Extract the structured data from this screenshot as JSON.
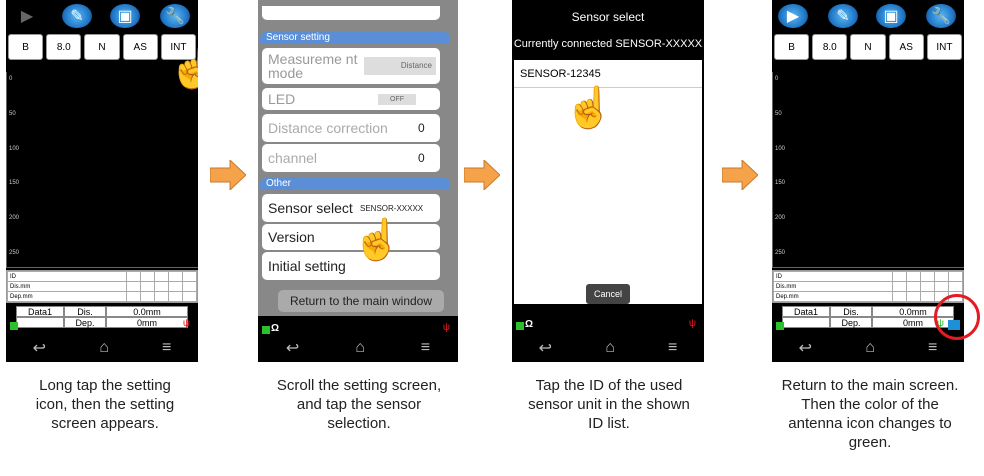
{
  "panel1": {
    "mode_buttons": [
      "B",
      "8.0",
      "N",
      "AS",
      "INT"
    ],
    "y_ticks": [
      "0",
      "50",
      "100",
      "150",
      "200",
      "250"
    ],
    "grid_rows": [
      "ID",
      "Dis.mm",
      "Dep.mm"
    ],
    "data_cells": [
      "Data1",
      "Dis.",
      "0.0mm",
      "",
      "Dep.",
      "0mm"
    ],
    "caption": [
      "Long tap the setting",
      "icon, then the setting",
      "screen appears."
    ]
  },
  "panel2": {
    "header_sensor": "Sensor setting",
    "measurement_label": "Measureme nt mode",
    "measurement_value": "Distance",
    "led_label": "LED",
    "led_value": "OFF",
    "distance_correction_label": "Distance correction",
    "distance_correction_value": "0",
    "channel_label": "channel",
    "channel_value": "0",
    "header_other": "Other",
    "sensor_select_label": "Sensor select",
    "sensor_select_value": "SENSOR-XXXXX",
    "version_label": "Version",
    "initial_setting_label": "Initial setting",
    "return_label": "Return to the main window",
    "caption": [
      "Scroll the setting screen,",
      "and tap the sensor",
      "selection."
    ]
  },
  "panel3": {
    "title": "Sensor select",
    "connected": "Currently connected SENSOR-XXXXX",
    "list_item": "SENSOR-12345",
    "cancel_label": "Cancel",
    "caption": [
      "Tap the ID of the used",
      "sensor unit in the shown",
      "ID list."
    ]
  },
  "panel4": {
    "mode_buttons": [
      "B",
      "8.0",
      "N",
      "AS",
      "INT"
    ],
    "y_ticks": [
      "0",
      "50",
      "100",
      "150",
      "200",
      "250"
    ],
    "grid_rows": [
      "ID",
      "Dis.mm",
      "Dep.mm"
    ],
    "data_cells": [
      "Data1",
      "Dis.",
      "0.0mm",
      "",
      "Dep.",
      "0mm"
    ],
    "caption": [
      "Return to the main screen.",
      "Then the color of the",
      "antenna icon changes to",
      "green."
    ]
  },
  "colors": {
    "accent_arrow": "#f5a24a",
    "highlight": "#e31b23",
    "antenna_before": "#e31b23",
    "antenna_after": "#2cc02c"
  }
}
